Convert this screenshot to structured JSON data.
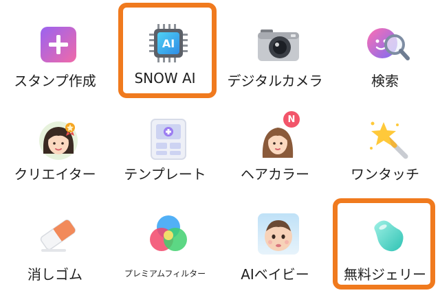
{
  "items": [
    {
      "label": "スタンプ作成",
      "icon": "plus-sticker-icon"
    },
    {
      "label": "SNOW AI",
      "icon": "ai-chip-icon"
    },
    {
      "label": "デジタルカメラ",
      "icon": "camera-icon"
    },
    {
      "label": "検索",
      "icon": "face-search-icon"
    },
    {
      "label": "クリエイター",
      "icon": "creator-avatar-icon"
    },
    {
      "label": "テンプレート",
      "icon": "template-icon"
    },
    {
      "label": "ヘアカラー",
      "icon": "hair-color-icon",
      "badge": "N"
    },
    {
      "label": "ワンタッチ",
      "icon": "magic-wand-icon"
    },
    {
      "label": "消しゴム",
      "icon": "eraser-icon"
    },
    {
      "label": "プレミアムフィルター",
      "icon": "premium-filter-icon"
    },
    {
      "label": "AIベイビー",
      "icon": "ai-baby-icon"
    },
    {
      "label": "無料ジェリー",
      "icon": "jelly-bean-icon"
    }
  ],
  "colors": {
    "highlight": "#f07a1e",
    "badge": "#f2556a"
  }
}
